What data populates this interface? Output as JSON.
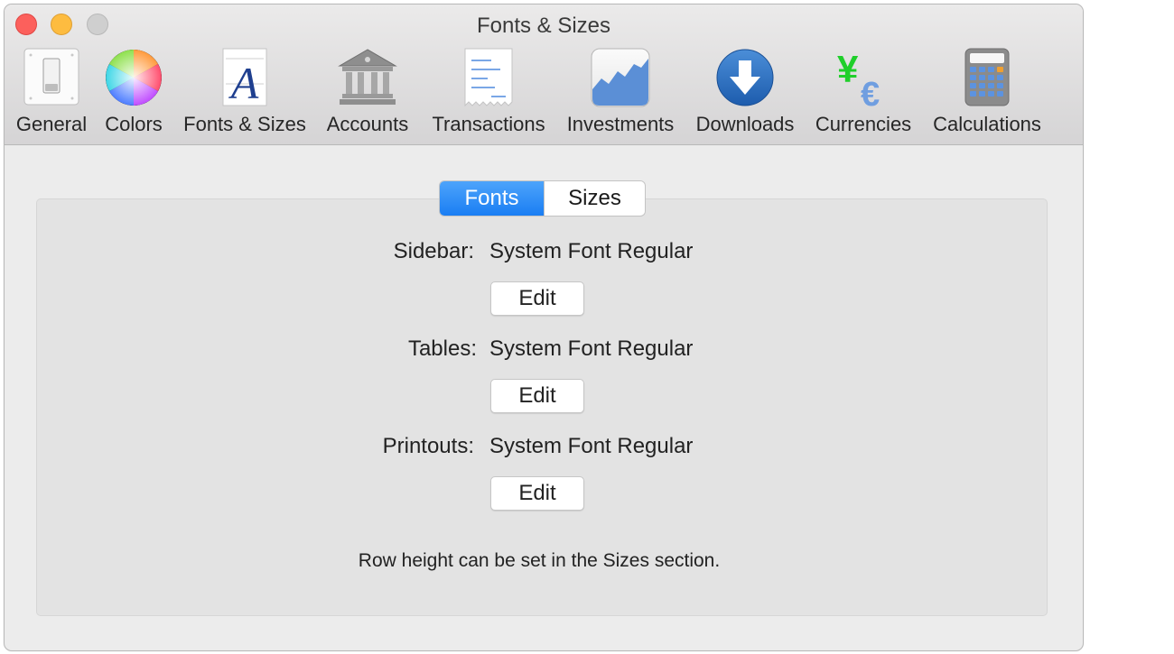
{
  "window": {
    "title": "Fonts & Sizes"
  },
  "toolbar": {
    "items": [
      {
        "label": "General",
        "icon": "general-switch-icon"
      },
      {
        "label": "Colors",
        "icon": "color-wheel-icon"
      },
      {
        "label": "Fonts & Sizes",
        "icon": "font-letter-a-icon"
      },
      {
        "label": "Accounts",
        "icon": "bank-building-icon"
      },
      {
        "label": "Transactions",
        "icon": "receipt-icon"
      },
      {
        "label": "Investments",
        "icon": "area-chart-icon"
      },
      {
        "label": "Downloads",
        "icon": "download-arrow-icon"
      },
      {
        "label": "Currencies",
        "icon": "yen-euro-icon"
      },
      {
        "label": "Calculations",
        "icon": "calculator-icon"
      }
    ]
  },
  "segments": {
    "fonts": "Fonts",
    "sizes": "Sizes",
    "selected": "Fonts"
  },
  "rows": [
    {
      "label": "Sidebar:",
      "value": "System Font Regular",
      "button": "Edit"
    },
    {
      "label": "Tables:",
      "value": "System Font Regular",
      "button": "Edit"
    },
    {
      "label": "Printouts:",
      "value": "System Font Regular",
      "button": "Edit"
    }
  ],
  "note": "Row height can be set in the Sizes section.",
  "colors": {
    "accent": "#1a7ef3",
    "close": "#fc605c",
    "minimize": "#fdbc40",
    "zoom": "#cfcfcf"
  }
}
